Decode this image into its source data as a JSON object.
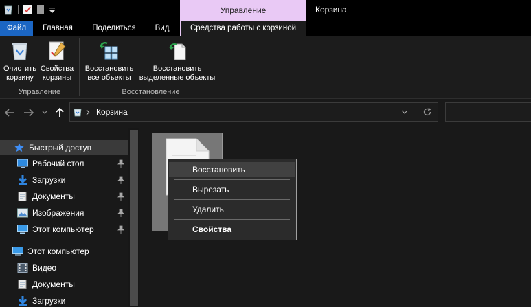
{
  "window": {
    "title": "Корзина",
    "context_group": "Управление"
  },
  "tabs": {
    "file": "Файл",
    "home": "Главная",
    "share": "Поделиться",
    "view": "Вид",
    "tools": "Средства работы с корзиной"
  },
  "ribbon": {
    "empty_bin_line1": "Очистить",
    "empty_bin_line2": "корзину",
    "props_line1": "Свойства",
    "props_line2": "корзины",
    "group_manage": "Управление",
    "restore_all_line1": "Восстановить",
    "restore_all_line2": "все объекты",
    "restore_sel_line1": "Восстановить",
    "restore_sel_line2": "выделенные объекты",
    "group_restore": "Восстановление"
  },
  "address": {
    "path": "Корзина",
    "search_placeholder": ""
  },
  "sidebar": {
    "items": [
      {
        "label": "Быстрый доступ"
      },
      {
        "label": "Рабочий стол"
      },
      {
        "label": "Загрузки"
      },
      {
        "label": "Документы"
      },
      {
        "label": "Изображения"
      },
      {
        "label": "Этот компьютер"
      },
      {
        "label": "Этот компьютер"
      },
      {
        "label": "Видео"
      },
      {
        "label": "Документы"
      },
      {
        "label": "Загрузки"
      }
    ]
  },
  "context_menu": {
    "restore": "Восстановить",
    "cut": "Вырезать",
    "delete": "Удалить",
    "properties": "Свойства"
  },
  "colors": {
    "file_tab": "#1b66c4",
    "context_group": "#e9c9f5",
    "background": "#191919",
    "accent_star": "#3f8ef5"
  }
}
